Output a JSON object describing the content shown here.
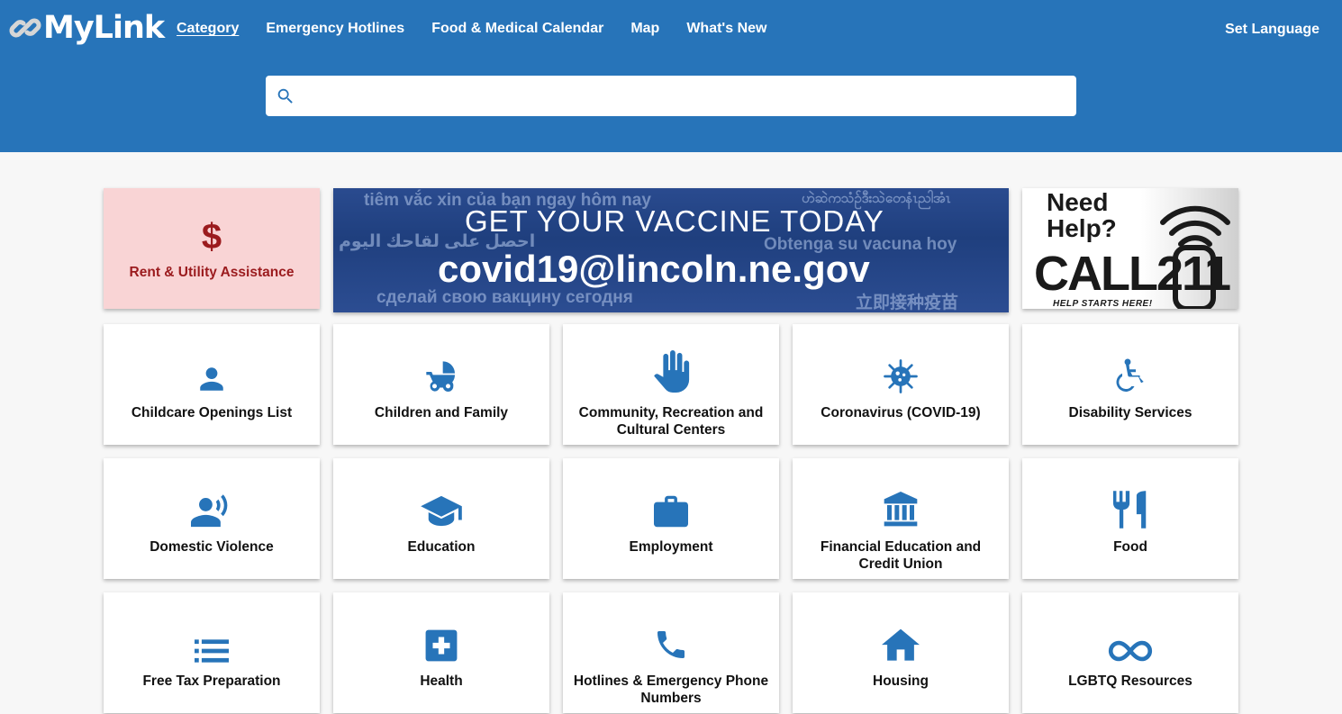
{
  "brand": {
    "name": "MyLink"
  },
  "nav": {
    "items": [
      {
        "label": "Category",
        "active": true
      },
      {
        "label": "Emergency Hotlines"
      },
      {
        "label": "Food & Medical Calendar"
      },
      {
        "label": "Map"
      },
      {
        "label": "What's New"
      }
    ],
    "set_language": "Set Language"
  },
  "search": {
    "placeholder": "",
    "value": ""
  },
  "featured": {
    "rent": {
      "symbol": "$",
      "label": "Rent & Utility Assistance"
    },
    "vaccine_banner": {
      "vietnamese": "tiêm vắc xin của bạn ngay hôm nay",
      "burmese": "ဟဲဆဲကသံဉ်ဒီးသဲတေနံၤညါအံၤ",
      "title": "GET YOUR VACCINE TODAY",
      "arabic": "احصل على لقاحك اليوم",
      "spanish": "Obtenga su vacuna hoy",
      "email": "covid19@lincoln.ne.gov",
      "russian": "сделай свою вакцину сегодня",
      "chinese": "立即接种疫苗"
    },
    "call211": {
      "line1": "Need",
      "line2": "Help?",
      "call": "CALL",
      "number": "211",
      "tagline": "HELP STARTS HERE!"
    }
  },
  "categories": [
    {
      "label": "Childcare Openings List",
      "icon": "person-icon"
    },
    {
      "label": "Children and Family",
      "icon": "stroller-icon"
    },
    {
      "label": "Community, Recreation and Cultural Centers",
      "icon": "hand-icon"
    },
    {
      "label": "Coronavirus (COVID-19)",
      "icon": "virus-icon"
    },
    {
      "label": "Disability Services",
      "icon": "wheelchair-icon"
    },
    {
      "label": "Domestic Violence",
      "icon": "person-voice-icon"
    },
    {
      "label": "Education",
      "icon": "graduation-cap-icon"
    },
    {
      "label": "Employment",
      "icon": "briefcase-icon"
    },
    {
      "label": "Financial Education and Credit Union",
      "icon": "bank-icon"
    },
    {
      "label": "Food",
      "icon": "utensils-icon"
    },
    {
      "label": "Free Tax Preparation",
      "icon": "list-icon"
    },
    {
      "label": "Health",
      "icon": "medical-plus-icon"
    },
    {
      "label": "Hotlines & Emergency Phone Numbers",
      "icon": "phone-icon"
    },
    {
      "label": "Housing",
      "icon": "house-icon"
    },
    {
      "label": "LGBTQ Resources",
      "icon": "infinity-icon"
    }
  ],
  "colors": {
    "header": "#2774b9",
    "icon": "#2774b9",
    "rent_bg": "#f9d4d5",
    "rent_text": "#9b1b1e"
  }
}
